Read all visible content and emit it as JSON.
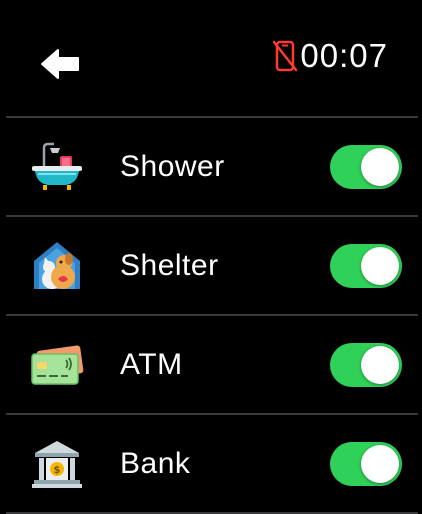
{
  "status": {
    "time": "00:07",
    "back_icon": "arrow-left-icon",
    "phone_indicator_icon": "phone-disconnected-icon",
    "phone_indicator_color": "#ff3b30"
  },
  "items": [
    {
      "label": "Shower",
      "icon": "bathtub-icon",
      "enabled": true
    },
    {
      "label": "Shelter",
      "icon": "shelter-pets-icon",
      "enabled": true
    },
    {
      "label": "ATM",
      "icon": "credit-card-icon",
      "enabled": true
    },
    {
      "label": "Bank",
      "icon": "bank-icon",
      "enabled": true
    }
  ],
  "colors": {
    "toggle_on": "#30d158",
    "divider": "#3a3a3c",
    "background": "#000000"
  }
}
